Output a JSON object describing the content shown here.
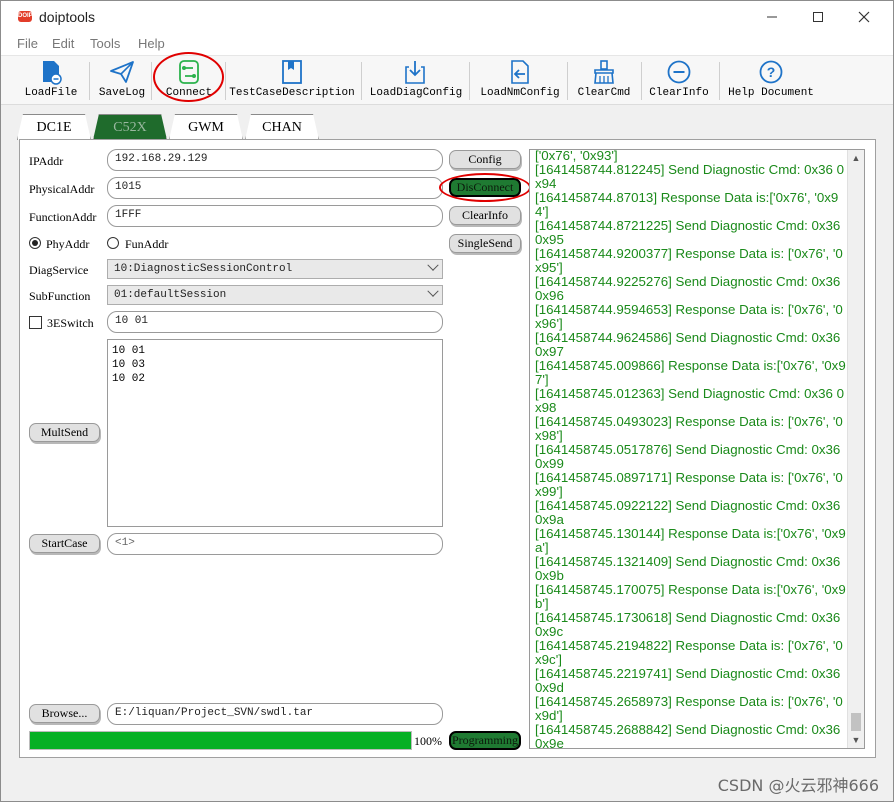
{
  "window": {
    "title": "doiptools",
    "icon_text": "DOIP"
  },
  "menu": [
    "File",
    "Edit",
    "Tools",
    "Help"
  ],
  "toolbar": {
    "items": [
      {
        "label": "LoadFile",
        "icon": "load-file-icon"
      },
      {
        "label": "SaveLog",
        "icon": "send-plane-icon"
      },
      {
        "label": "Connect",
        "icon": "connect-icon"
      },
      {
        "label": "TestCaseDescription",
        "icon": "book-icon"
      },
      {
        "label": "LoadDiagConfig",
        "icon": "load-diag-config-icon"
      },
      {
        "label": "LoadNmConfig",
        "icon": "load-nm-config-icon"
      },
      {
        "label": "ClearCmd",
        "icon": "broom-icon"
      },
      {
        "label": "ClearInfo",
        "icon": "minus-circle-icon"
      },
      {
        "label": "Help Document",
        "icon": "help-circle-icon"
      }
    ]
  },
  "tabs": [
    "DC1E",
    "C52X",
    "GWM",
    "CHAN"
  ],
  "active_tab": "C52X",
  "form": {
    "ipaddr_label": "IPAddr",
    "ipaddr_value": "192.168.29.129",
    "physical_label": "PhysicalAddr",
    "physical_value": "1015",
    "function_label": "FunctionAddr",
    "function_value": "1FFF",
    "phyaddr_radio": "PhyAddr",
    "funaddr_radio": "FunAddr",
    "diag_service_label": "DiagService",
    "diag_service_value": "10:DiagnosticSessionControl",
    "subfunction_label": "SubFunction",
    "subfunction_value": "01:defaultSession",
    "switch_label": "3ESwitch",
    "switch_value": "10 01",
    "multi_lines": [
      "10 01",
      "10 03",
      "10 02"
    ],
    "startcase_value": "<1>",
    "browse_path": "E:/liquan/Project_SVN/swdl.tar",
    "progress_pct": 100,
    "progress_text": "100%"
  },
  "buttons": {
    "config": "Config",
    "disconnect": "DisConnect",
    "clear_info": "ClearInfo",
    "single_send": "SingleSend",
    "mult_send": "MultSend",
    "start_case": "StartCase",
    "browse": "Browse...",
    "programming": "Programming"
  },
  "log_lines": [
    "['0x76', '0x93']",
    "[1641458744.812245] Send Diagnostic Cmd: 0x36 0x94",
    "[1641458744.87013] Response Data is:['0x76', '0x94']",
    "[1641458744.8721225] Send Diagnostic Cmd: 0x36 0x95",
    "[1641458744.9200377] Response Data is: ['0x76', '0x95']",
    "[1641458744.9225276] Send Diagnostic Cmd: 0x36 0x96",
    "[1641458744.9594653] Response Data is: ['0x76', '0x96']",
    "[1641458744.9624586] Send Diagnostic Cmd: 0x36 0x97",
    "[1641458745.009866] Response Data is:['0x76', '0x97']",
    "[1641458745.012363] Send Diagnostic Cmd: 0x36 0x98",
    "[1641458745.0493023] Response Data is: ['0x76', '0x98']",
    "[1641458745.0517876] Send Diagnostic Cmd: 0x36 0x99",
    "[1641458745.0897171] Response Data is: ['0x76', '0x99']",
    "[1641458745.0922122] Send Diagnostic Cmd: 0x36 0x9a",
    "[1641458745.130144] Response Data is:['0x76', '0x9a']",
    "[1641458745.1321409] Send Diagnostic Cmd: 0x36 0x9b",
    "[1641458745.170075] Response Data is:['0x76', '0x9b']",
    "[1641458745.1730618] Send Diagnostic Cmd: 0x36 0x9c",
    "[1641458745.2194822] Response Data is: ['0x76', '0x9c']",
    "[1641458745.2219741] Send Diagnostic Cmd: 0x36 0x9d",
    "[1641458745.2658973] Response Data is: ['0x76', '0x9d']",
    "[1641458745.2688842] Send Diagnostic Cmd: 0x36 0x9e"
  ],
  "watermark": "CSDN @火云邪神666",
  "colors": {
    "accent_green": "#1f6b2c",
    "log_green": "#1a8a1a",
    "progress_green": "#06b025",
    "highlight_red": "#e00000"
  }
}
